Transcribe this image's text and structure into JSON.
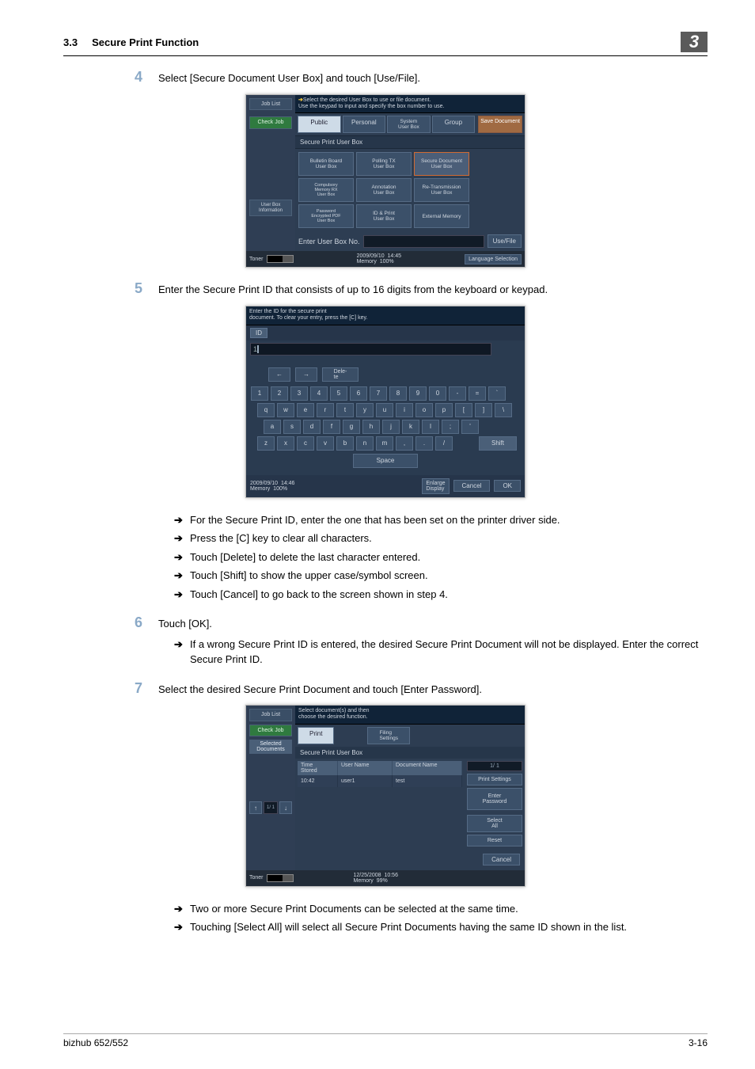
{
  "header": {
    "section": "3.3",
    "title": "Secure Print Function",
    "chapter": "3"
  },
  "steps": {
    "s4": {
      "num": "4",
      "text": "Select [Secure Document User Box] and touch [Use/File]."
    },
    "s5": {
      "num": "5",
      "text": "Enter the Secure Print ID that consists of up to 16 digits from the keyboard or keypad."
    },
    "s6": {
      "num": "6",
      "text": "Touch [OK]."
    },
    "s7": {
      "num": "7",
      "text": "Select the desired Secure Print Document and touch [Enter Password]."
    }
  },
  "bullets5": [
    "For the Secure Print ID, enter the one that has been set on the printer driver side.",
    "Press the [C] key to clear all characters.",
    "Touch [Delete] to delete the last character entered.",
    "Touch [Shift] to show the upper case/symbol screen.",
    "Touch [Cancel] to go back to the screen shown in step 4."
  ],
  "bullets6": [
    "If a wrong Secure Print ID is entered, the desired Secure Print Document will not be displayed. Enter the correct Secure Print ID."
  ],
  "bullets7": [
    "Two or more Secure Print Documents can be selected at the same time.",
    "Touching [Select All] will select all Secure Print Documents having the same ID shown in the list."
  ],
  "screen1": {
    "side": {
      "joblist": "Job List",
      "checkjob": "Check Job",
      "userboxinfo": "User Box\nInformation"
    },
    "tip": "Select the desired User Box to use or file document.\nUse the keypad to input and specify the box number to use.",
    "tabs": [
      "Public",
      "Personal",
      "System\nUser Box",
      "Group"
    ],
    "save": "Save Document",
    "band": "Secure Print User Box",
    "boxes": [
      "Bulletin Board\nUser Box",
      "Polling TX\nUser Box",
      "Secure Document\nUser Box",
      "Compulsory\nMemory RX\nUser Box",
      "Annotation\nUser Box",
      "Re-Transmission\nUser Box",
      "Password\nEncrypted PDF\nUser Box",
      "ID & Print\nUser Box",
      "External Memory"
    ],
    "enter": "Enter User Box No.",
    "usefile": "Use/File",
    "foot": {
      "toner": "Toner",
      "date": "2009/09/10",
      "time": "14:45",
      "memory": "Memory",
      "mempct": "100%",
      "lang": "Language Selection"
    }
  },
  "screen2": {
    "tip": "Enter the ID for the secure print\ndocument. To clear your entry, press the [C] key.",
    "idlabel": "ID",
    "idvalue": "1",
    "delete": "Dele-\nte",
    "rows": [
      [
        "1",
        "2",
        "3",
        "4",
        "5",
        "6",
        "7",
        "8",
        "9",
        "0",
        "-",
        "=",
        "`"
      ],
      [
        "q",
        "w",
        "e",
        "r",
        "t",
        "y",
        "u",
        "i",
        "o",
        "p",
        "[",
        "]",
        "\\"
      ],
      [
        "a",
        "s",
        "d",
        "f",
        "g",
        "h",
        "j",
        "k",
        "l",
        ";",
        "'"
      ],
      [
        "z",
        "x",
        "c",
        "v",
        "b",
        "n",
        "m",
        ",",
        ".",
        "/"
      ]
    ],
    "shift": "Shift",
    "space": "Space",
    "enlarge": "Enlarge\nDisplay",
    "cancel": "Cancel",
    "ok": "OK",
    "foot": {
      "date": "2009/09/10",
      "time": "14:46",
      "memory": "Memory",
      "mempct": "100%"
    }
  },
  "screen3": {
    "side": {
      "joblist": "Job List",
      "checkjob": "Check Job",
      "selected": "Selected Documents",
      "page": "1/  1"
    },
    "tip": "Select document(s) and then\nchoose the desired function.",
    "print": "Print",
    "filing": "Filing\nSettings",
    "band": "Secure Print User Box",
    "columns": [
      "Time\nStored",
      "User Name",
      "Document Name"
    ],
    "row": [
      "10:42",
      "user1",
      "test"
    ],
    "page": "1/  1",
    "printset": "Print Settings",
    "enterpwd": "Enter\nPassword",
    "selectall": "Select\nAll",
    "reset": "Reset",
    "cancel": "Cancel",
    "foot": {
      "toner": "Toner",
      "date": "12/25/2008",
      "time": "10:56",
      "memory": "Memory",
      "mempct": "99%"
    }
  },
  "footer": {
    "left": "bizhub 652/552",
    "right": "3-16"
  }
}
